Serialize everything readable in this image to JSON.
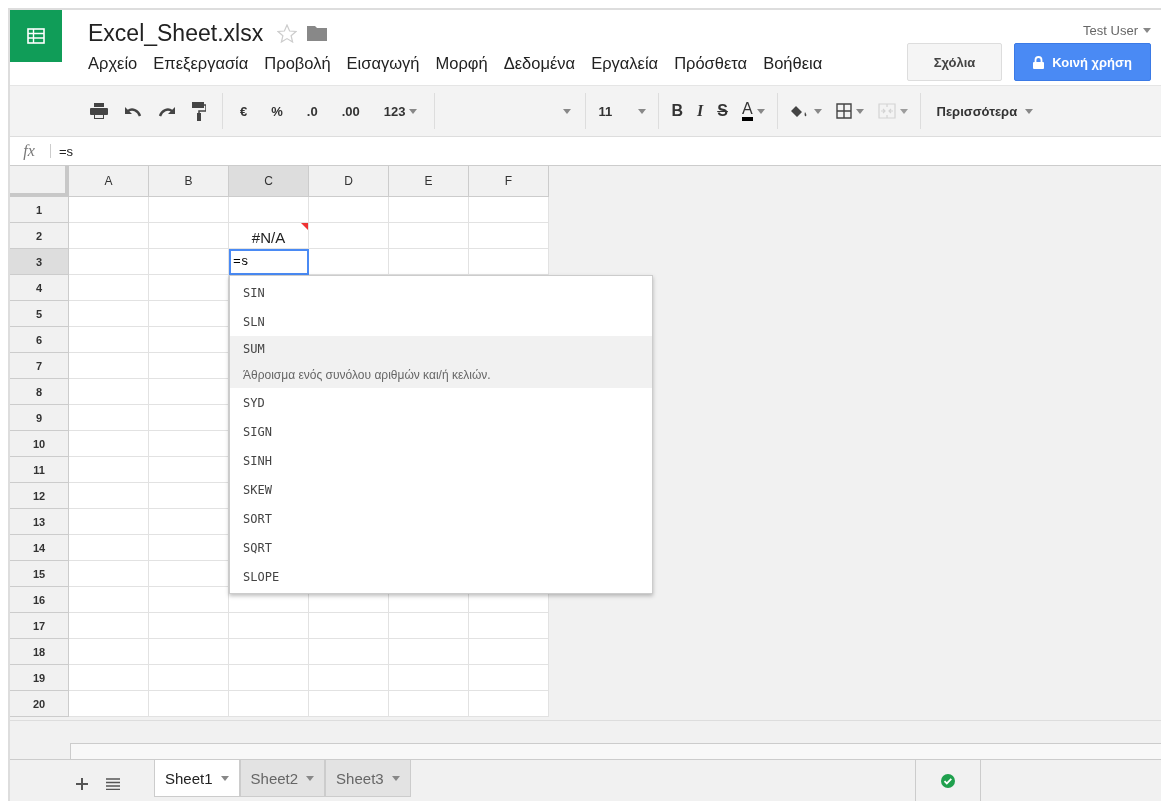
{
  "document": {
    "title": "Excel_Sheet.xlsx"
  },
  "user": "Test User",
  "menu": [
    "Αρχείο",
    "Επεξεργασία",
    "Προβολή",
    "Εισαγωγή",
    "Μορφή",
    "Δεδομένα",
    "Εργαλεία",
    "Πρόσθετα",
    "Βοήθεια"
  ],
  "buttons": [
    {
      "label": "Σχόλια",
      "kind": "plain"
    },
    {
      "label": "Κοινή χρήση",
      "kind": "share"
    }
  ],
  "toolbar": {
    "number_formats": [
      "€",
      "%",
      ".0",
      ".00",
      "123"
    ],
    "font_size": "11",
    "text_styles": [
      "B",
      "I",
      "S",
      "A"
    ],
    "more": "Περισσότερα"
  },
  "formula_bar": {
    "label": "fx",
    "value": "=s"
  },
  "columns": [
    {
      "label": "A",
      "selected": false
    },
    {
      "label": "B",
      "selected": false
    },
    {
      "label": "C",
      "selected": true
    },
    {
      "label": "D",
      "selected": false
    },
    {
      "label": "E",
      "selected": false
    },
    {
      "label": "F",
      "selected": false
    }
  ],
  "rows": [
    {
      "label": "1",
      "selected": false
    },
    {
      "label": "2",
      "selected": false,
      "cells": [
        {
          "kind": "empty"
        },
        {
          "kind": "empty"
        },
        {
          "text": "#N/A",
          "kind": "error"
        },
        {
          "kind": "empty"
        },
        {
          "kind": "empty"
        },
        {
          "kind": "empty"
        }
      ]
    },
    {
      "label": "3",
      "selected": true,
      "cells": [
        {
          "kind": "empty"
        },
        {
          "kind": "empty"
        },
        {
          "text": "=s",
          "kind": "editor"
        },
        {
          "kind": "empty"
        },
        {
          "kind": "empty"
        },
        {
          "kind": "empty"
        }
      ]
    },
    {
      "label": "4",
      "selected": false
    },
    {
      "label": "5",
      "selected": false
    },
    {
      "label": "6",
      "selected": false
    },
    {
      "label": "7",
      "selected": false
    },
    {
      "label": "8",
      "selected": false
    },
    {
      "label": "9",
      "selected": false
    },
    {
      "label": "10",
      "selected": false
    },
    {
      "label": "11",
      "selected": false
    },
    {
      "label": "12",
      "selected": false
    },
    {
      "label": "13",
      "selected": false
    },
    {
      "label": "14",
      "selected": false
    },
    {
      "label": "15",
      "selected": false
    },
    {
      "label": "16",
      "selected": false
    },
    {
      "label": "17",
      "selected": false
    },
    {
      "label": "18",
      "selected": false
    },
    {
      "label": "19",
      "selected": false
    },
    {
      "label": "20",
      "selected": false
    }
  ],
  "autocomplete": [
    {
      "name": "SIN",
      "selected": false
    },
    {
      "name": "SLN",
      "selected": false
    },
    {
      "name": "SUM",
      "selected": true,
      "description": "Άθροισμα ενός συνόλου αριθμών και/ή κελιών."
    },
    {
      "name": "SYD",
      "selected": false
    },
    {
      "name": "SIGN",
      "selected": false
    },
    {
      "name": "SINH",
      "selected": false
    },
    {
      "name": "SKEW",
      "selected": false
    },
    {
      "name": "SORT",
      "selected": false
    },
    {
      "name": "SQRT",
      "selected": false
    },
    {
      "name": "SLOPE",
      "selected": false
    }
  ],
  "sheets": [
    {
      "label": "Sheet1",
      "selected": true
    },
    {
      "label": "Sheet2",
      "selected": false
    },
    {
      "label": "Sheet3",
      "selected": false
    }
  ],
  "saved": true
}
